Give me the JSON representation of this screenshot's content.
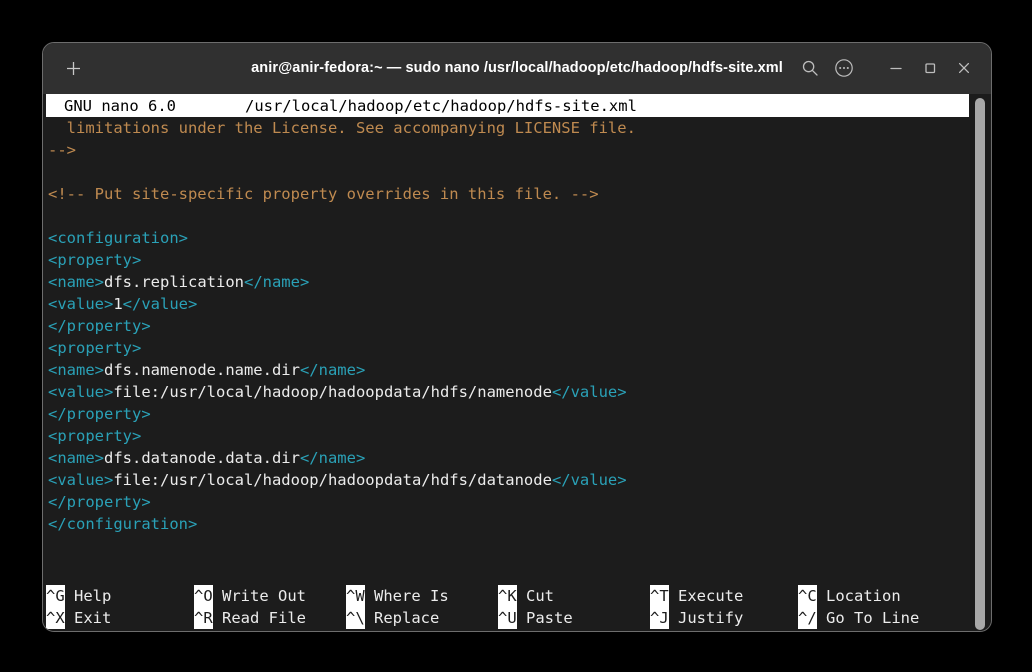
{
  "window": {
    "title": "anir@anir-fedora:~ — sudo nano /usr/local/hadoop/etc/hadoop/hdfs-site.xml",
    "new_tab_icon": "plus-icon",
    "controls": [
      {
        "name": "search-icon",
        "label": "Search"
      },
      {
        "name": "menu-icon",
        "label": "Menu"
      },
      {
        "name": "minimize-icon",
        "label": "Minimize"
      },
      {
        "name": "maximize-icon",
        "label": "Maximize"
      },
      {
        "name": "close-icon",
        "label": "Close"
      }
    ]
  },
  "nano": {
    "version": "GNU nano 6.0",
    "filename": "/usr/local/hadoop/etc/hadoop/hdfs-site.xml",
    "lines": [
      {
        "indent": "  ",
        "segments": [
          {
            "kind": "comment",
            "text": "limitations under the License. See accompanying LICENSE file."
          }
        ]
      },
      {
        "indent": "",
        "segments": [
          {
            "kind": "comment",
            "text": "-->"
          }
        ]
      },
      {
        "indent": "",
        "segments": []
      },
      {
        "indent": "",
        "segments": [
          {
            "kind": "comment",
            "text": "<!-- Put site-specific property overrides in this file. -->"
          }
        ]
      },
      {
        "indent": "",
        "segments": []
      },
      {
        "indent": "",
        "segments": [
          {
            "kind": "tag",
            "text": "<configuration>"
          }
        ]
      },
      {
        "indent": "",
        "segments": [
          {
            "kind": "tag",
            "text": "<property>"
          }
        ]
      },
      {
        "indent": "",
        "segments": [
          {
            "kind": "tag",
            "text": "<name>"
          },
          {
            "kind": "text",
            "text": "dfs.replication"
          },
          {
            "kind": "tag",
            "text": "</name>"
          }
        ]
      },
      {
        "indent": "",
        "segments": [
          {
            "kind": "tag",
            "text": "<value>"
          },
          {
            "kind": "text",
            "text": "1"
          },
          {
            "kind": "tag",
            "text": "</value>"
          }
        ]
      },
      {
        "indent": "",
        "segments": [
          {
            "kind": "tag",
            "text": "</property>"
          }
        ]
      },
      {
        "indent": "",
        "segments": [
          {
            "kind": "tag",
            "text": "<property>"
          }
        ]
      },
      {
        "indent": "",
        "segments": [
          {
            "kind": "tag",
            "text": "<name>"
          },
          {
            "kind": "text",
            "text": "dfs.namenode.name.dir"
          },
          {
            "kind": "tag",
            "text": "</name>"
          }
        ]
      },
      {
        "indent": "",
        "segments": [
          {
            "kind": "tag",
            "text": "<value>"
          },
          {
            "kind": "text",
            "text": "file:/usr/local/hadoop/hadoopdata/hdfs/namenode"
          },
          {
            "kind": "tag",
            "text": "</value>"
          }
        ]
      },
      {
        "indent": "",
        "segments": [
          {
            "kind": "tag",
            "text": "</property>"
          }
        ]
      },
      {
        "indent": "",
        "segments": [
          {
            "kind": "tag",
            "text": "<property>"
          }
        ]
      },
      {
        "indent": "",
        "segments": [
          {
            "kind": "tag",
            "text": "<name>"
          },
          {
            "kind": "text",
            "text": "dfs.datanode.data.dir"
          },
          {
            "kind": "tag",
            "text": "</name>"
          }
        ]
      },
      {
        "indent": "",
        "segments": [
          {
            "kind": "tag",
            "text": "<value>"
          },
          {
            "kind": "text",
            "text": "file:/usr/local/hadoop/hadoopdata/hdfs/datanode"
          },
          {
            "kind": "tag",
            "text": "</value>"
          }
        ]
      },
      {
        "indent": "",
        "segments": [
          {
            "kind": "tag",
            "text": "</property>"
          }
        ]
      },
      {
        "indent": "",
        "segments": [
          {
            "kind": "tag",
            "text": "</configuration>"
          }
        ]
      }
    ],
    "shortcuts": {
      "row1": [
        {
          "key": "^G",
          "label": "Help"
        },
        {
          "key": "^O",
          "label": "Write Out"
        },
        {
          "key": "^W",
          "label": "Where Is"
        },
        {
          "key": "^K",
          "label": "Cut"
        },
        {
          "key": "^T",
          "label": "Execute"
        },
        {
          "key": "^C",
          "label": "Location"
        }
      ],
      "row2": [
        {
          "key": "^X",
          "label": "Exit"
        },
        {
          "key": "^R",
          "label": "Read File"
        },
        {
          "key": "^\\",
          "label": "Replace"
        },
        {
          "key": "^U",
          "label": "Paste"
        },
        {
          "key": "^J",
          "label": "Justify"
        },
        {
          "key": "^/",
          "label": "Go To Line"
        }
      ]
    }
  },
  "colors": {
    "comment": "#bf8a50",
    "tag": "#2aa1b7",
    "text": "#ececec",
    "terminal_bg": "#1c1c1c",
    "titlebar_bg": "#303030",
    "inverse_bg": "#ffffff",
    "scrollbar": "#a8a8a8"
  }
}
